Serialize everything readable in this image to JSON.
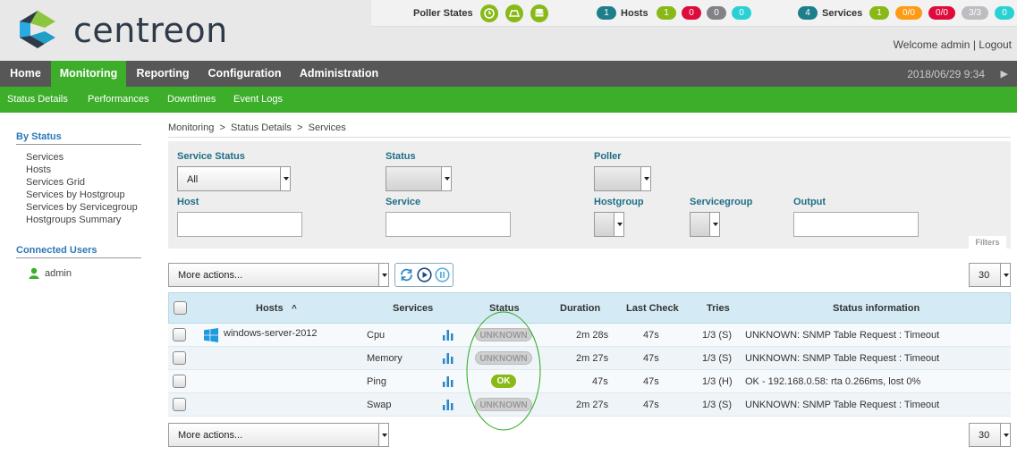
{
  "header": {
    "logo_text": "centreon",
    "poller_states_label": "Poller States",
    "hosts_label": "Hosts",
    "hosts_total": "1",
    "hosts_counts": [
      "1",
      "0",
      "0",
      "0"
    ],
    "services_label": "Services",
    "services_total": "4",
    "services_counts": [
      "1",
      "0/0",
      "0/0",
      "3/3",
      "0"
    ],
    "welcome_text": "Welcome admin",
    "logout_text": "Logout",
    "separator": "|"
  },
  "nav": {
    "items": [
      "Home",
      "Monitoring",
      "Reporting",
      "Configuration",
      "Administration"
    ],
    "active": "Monitoring",
    "datetime": "2018/06/29 9:34"
  },
  "subnav": {
    "items": [
      "Status Details",
      "Performances",
      "Downtimes",
      "Event Logs"
    ]
  },
  "sidebar": {
    "by_status_title": "By Status",
    "links": [
      "Services",
      "Hosts",
      "Services Grid",
      "Services by Hostgroup",
      "Services by Servicegroup",
      "Hostgroups Summary"
    ],
    "connected_users_title": "Connected Users",
    "users": [
      "admin"
    ]
  },
  "breadcrumb": {
    "items": [
      "Monitoring",
      "Status Details",
      "Services"
    ],
    "sep": ">"
  },
  "filters": {
    "service_status_label": "Service Status",
    "service_status_value": "All",
    "status_label": "Status",
    "poller_label": "Poller",
    "host_label": "Host",
    "service_label": "Service",
    "hostgroup_label": "Hostgroup",
    "servicegroup_label": "Servicegroup",
    "output_label": "Output",
    "filters_tab": "Filters"
  },
  "actions": {
    "more_actions_label": "More actions...",
    "page_size": "30"
  },
  "table": {
    "columns": [
      "Hosts",
      "Services",
      "Status",
      "Duration",
      "Last Check",
      "Tries",
      "Status information"
    ],
    "sort_indicator": "^",
    "rows": [
      {
        "host": "windows-server-2012",
        "service": "Cpu",
        "status": "UNKNOWN",
        "duration": "2m 28s",
        "last_check": "47s",
        "tries": "1/3 (S)",
        "info": "UNKNOWN: SNMP Table Request : Timeout"
      },
      {
        "host": "",
        "service": "Memory",
        "status": "UNKNOWN",
        "duration": "2m 27s",
        "last_check": "47s",
        "tries": "1/3 (S)",
        "info": "UNKNOWN: SNMP Table Request : Timeout"
      },
      {
        "host": "",
        "service": "Ping",
        "status": "OK",
        "duration": "47s",
        "last_check": "47s",
        "tries": "1/3 (H)",
        "info": "OK - 192.168.0.58: rta 0.266ms, lost 0%"
      },
      {
        "host": "",
        "service": "Swap",
        "status": "UNKNOWN",
        "duration": "2m 27s",
        "last_check": "47s",
        "tries": "1/3 (S)",
        "info": "UNKNOWN: SNMP Table Request : Timeout"
      }
    ]
  },
  "colors": {
    "brand_green": "#3cae29",
    "ok": "#88b917",
    "critical": "#e00b3d",
    "unknown": "#cfcfcf",
    "pending": "#2ad1d4",
    "nav_bg": "#575757",
    "annotation_ellipse": "#2aa81a"
  }
}
